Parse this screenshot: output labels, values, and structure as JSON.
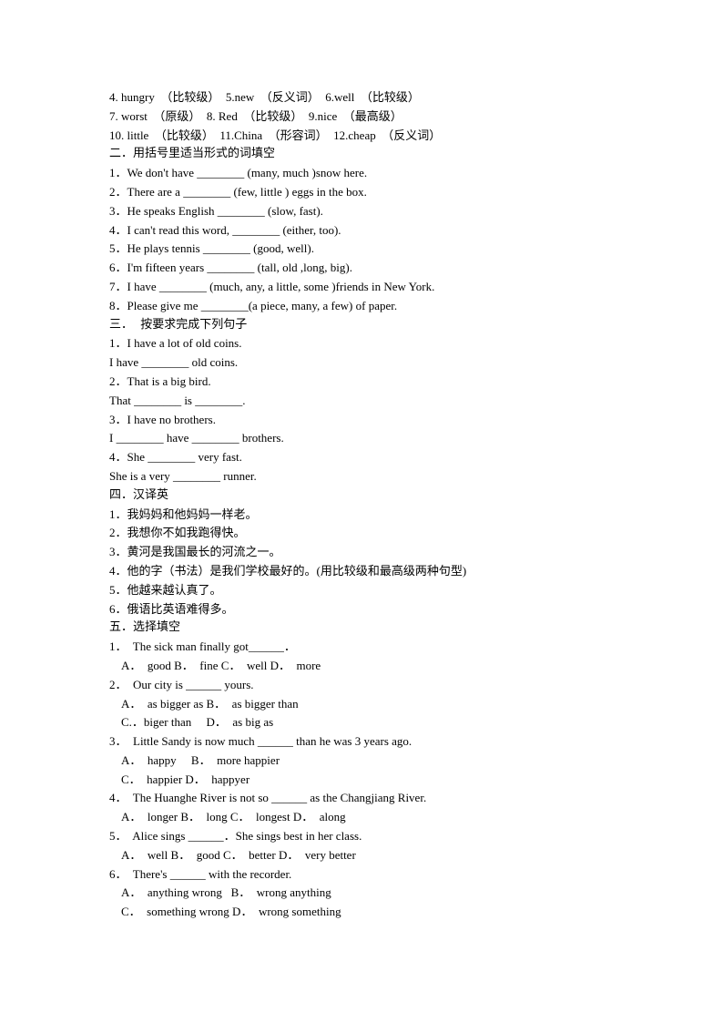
{
  "lines": [
    {
      "text": "4. hungry  （比较级）  5.new  （反义词）  6.well  （比较级）",
      "type": "text"
    },
    {
      "text": "7. worst  （原级）  8. Red  （比较级）  9.nice  （最高级）",
      "type": "text"
    },
    {
      "text": "10. little  （比较级）  11.China  （形容词）  12.cheap  （反义词）",
      "type": "text"
    },
    {
      "text": "二．用括号里适当形式的词填空",
      "type": "heading"
    },
    {
      "text": "1．We don't have ________ (many, much )snow here.",
      "type": "text"
    },
    {
      "text": "2．There are a ________ (few, little ) eggs in the box.",
      "type": "text"
    },
    {
      "text": "3．He speaks English ________ (slow, fast).",
      "type": "text"
    },
    {
      "text": "4．I can't read this word, ________ (either, too).",
      "type": "text"
    },
    {
      "text": "5．He plays tennis ________ (good, well).",
      "type": "text"
    },
    {
      "text": "6．I'm fifteen years ________ (tall, old ,long, big).",
      "type": "text"
    },
    {
      "text": "7．I have ________ (much, any, a little, some )friends in New York.",
      "type": "text"
    },
    {
      "text": "8．Please give me ________(a piece, many, a few) of paper.",
      "type": "text"
    },
    {
      "text": "三．  按要求完成下列句子",
      "type": "heading"
    },
    {
      "text": "1．I have a lot of old coins.",
      "type": "text"
    },
    {
      "text": "I have ________ old coins.",
      "type": "text"
    },
    {
      "text": "2．That is a big bird.",
      "type": "text"
    },
    {
      "text": "That ________ is ________.",
      "type": "text"
    },
    {
      "text": "3．I have no brothers.",
      "type": "text"
    },
    {
      "text": "I ________ have ________ brothers.",
      "type": "text"
    },
    {
      "text": "4．She ________ very fast.",
      "type": "text"
    },
    {
      "text": "She is a very ________ runner.",
      "type": "text"
    },
    {
      "text": "四．汉译英",
      "type": "heading"
    },
    {
      "text": "1．我妈妈和他妈妈一样老。",
      "type": "text"
    },
    {
      "text": "2．我想你不如我跑得快。",
      "type": "text"
    },
    {
      "text": "3．黄河是我国最长的河流之一。",
      "type": "text"
    },
    {
      "text": "4．他的字（书法）是我们学校最好的。(用比较级和最高级两种句型)",
      "type": "text"
    },
    {
      "text": "5．他越来越认真了。",
      "type": "text"
    },
    {
      "text": "6．俄语比英语难得多。",
      "type": "text"
    },
    {
      "text": "五．选择填空",
      "type": "heading"
    },
    {
      "text": "1．  The sick man finally got______．",
      "type": "text"
    },
    {
      "text": "A．  good B．  fine C．  well D．  more",
      "type": "option"
    },
    {
      "text": "2．  Our city is ______ yours.",
      "type": "text"
    },
    {
      "text": "A．  as bigger as B．  as bigger than",
      "type": "option"
    },
    {
      "text": "C.．biger than     D．  as big as",
      "type": "option"
    },
    {
      "text": "3．  Little Sandy is now much ______ than he was 3 years ago.",
      "type": "text"
    },
    {
      "text": "A．  happy     B．  more happier",
      "type": "option"
    },
    {
      "text": "C．  happier D．  happyer",
      "type": "option"
    },
    {
      "text": "4．  The Huanghe River is not so ______ as the Changjiang River.",
      "type": "text"
    },
    {
      "text": "A．  longer B．  long C．  longest D．  along",
      "type": "option"
    },
    {
      "text": "5．  Alice sings ______．She sings best in her class.",
      "type": "text"
    },
    {
      "text": "A．  well B．  good C．  better D．  very better",
      "type": "option"
    },
    {
      "text": "6．  There's ______ with the recorder.",
      "type": "text"
    },
    {
      "text": "A．  anything wrong   B．  wrong anything",
      "type": "option"
    },
    {
      "text": "C．  something wrong D．  wrong something",
      "type": "option"
    }
  ]
}
